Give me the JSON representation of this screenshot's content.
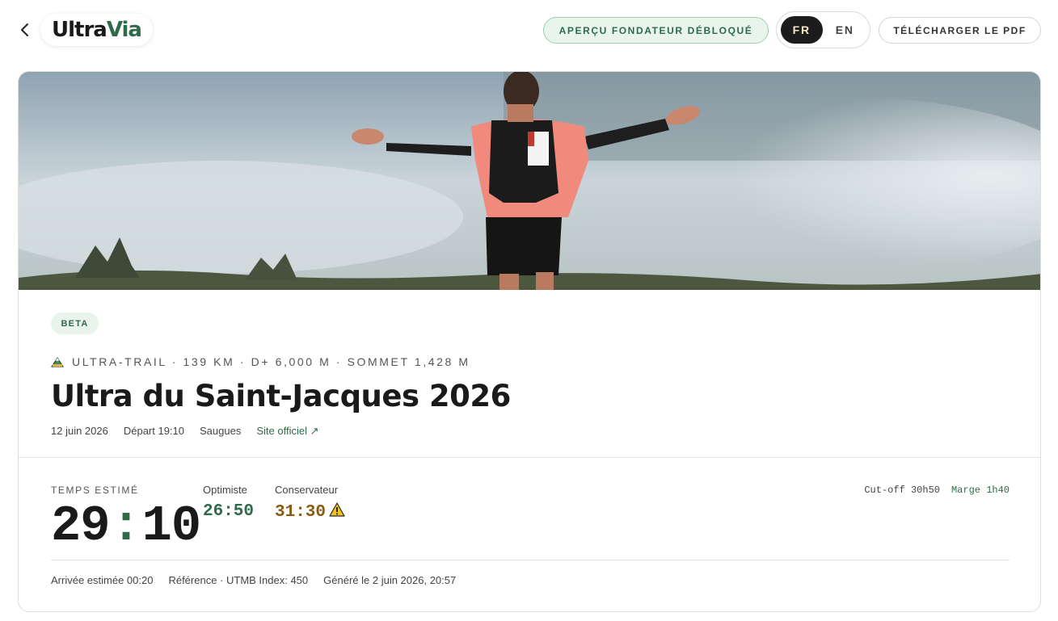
{
  "header": {
    "back_icon": "chevron-left-icon",
    "logo_part1": "Ultra",
    "logo_part2": "Via",
    "founder_badge": "APERÇU FONDATEUR DÉBLOQUÉ",
    "lang_fr": "FR",
    "lang_en": "EN",
    "active_lang": "FR",
    "pdf_button": "TÉLÉCHARGER LE PDF"
  },
  "race": {
    "badge": "BETA",
    "meta_icon": "mountain-icon",
    "meta": "ULTRA-TRAIL · 139 KM · D+ 6,000 M · SOMMET 1,428 M",
    "title": "Ultra du Saint-Jacques 2026",
    "date": "12 juin 2026",
    "departure": "Départ 19:10",
    "location": "Saugues",
    "site_link": "Site officiel ↗"
  },
  "estimate": {
    "label": "TEMPS ESTIMÉ",
    "hours": "29",
    "colon": ":",
    "minutes": "10",
    "optimistic_label": "Optimiste",
    "optimistic_value": "26:50",
    "conservative_label": "Conservateur",
    "conservative_value": "31:30",
    "conservative_icon": "warning-icon",
    "cutoff": "Cut-off 30h50",
    "margin": "Marge 1h40"
  },
  "footer": {
    "arrival": "Arrivée estimée 00:20",
    "reference": "Référence · UTMB Index: 450",
    "generated": "Généré le 2 juin 2026, 20:57"
  },
  "colors": {
    "brand_green": "#2f6b4a",
    "warning_brown": "#8a5a12",
    "dark": "#1c1c1c"
  }
}
